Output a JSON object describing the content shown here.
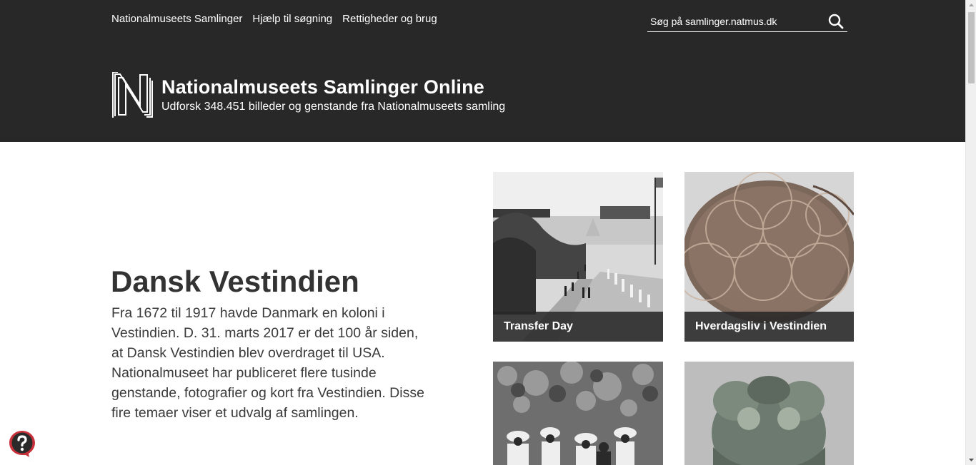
{
  "topnav": {
    "items": [
      "Nationalmuseets Samlinger",
      "Hjælp til søgning",
      "Rettigheder og brug"
    ]
  },
  "search": {
    "placeholder": "Søg på samlinger.natmus.dk"
  },
  "site": {
    "title": "Nationalmuseets Samlinger Online",
    "subtitle": "Udforsk 348.451 billeder og genstande fra Nationalmuseets samling"
  },
  "intro": {
    "title": "Dansk Vestindien",
    "text": "Fra 1672 til 1917 havde Danmark en koloni i Vestindien. D. 31. marts 2017 er det 100 år siden, at Dansk Vestindien blev overdraget til USA. Nationalmuseet har publiceret flere tusinde genstande, fotografier og kort fra Vestindien. Disse fire temaer viser et udvalg af samlingen."
  },
  "tiles": [
    {
      "caption": "Transfer Day"
    },
    {
      "caption": "Hverdagsliv i Vestindien"
    }
  ],
  "icons": {
    "search": "search-icon",
    "help": "help-icon",
    "logo": "natmus-logo"
  },
  "colors": {
    "header_bg": "#282828",
    "caption_bg": "#282828",
    "help_accent": "#c8313a"
  }
}
